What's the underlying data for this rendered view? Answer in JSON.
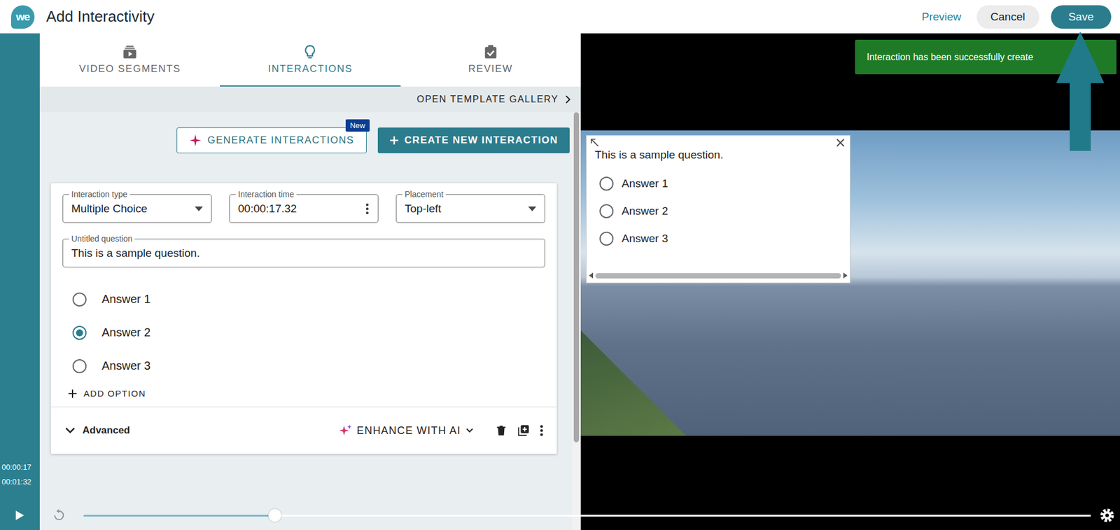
{
  "header": {
    "logo": "we",
    "title": "Add Interactivity",
    "buttons": [
      {
        "label": "Preview",
        "kind": "link"
      },
      {
        "label": "Cancel",
        "kind": "secondary"
      },
      {
        "label": "Save",
        "kind": "primary"
      }
    ]
  },
  "tabs": [
    {
      "label": "VIDEO SEGMENTS",
      "selected": false
    },
    {
      "label": "INTERACTIONS",
      "selected": true
    },
    {
      "label": "REVIEW",
      "selected": false
    }
  ],
  "template_gallery": {
    "label": "OPEN TEMPLATE GALLERY"
  },
  "actions": {
    "generate": {
      "label": "GENERATE INTERACTIONS",
      "badge": "New"
    },
    "create": {
      "label": "CREATE NEW INTERACTION"
    }
  },
  "interaction": {
    "fields": [
      {
        "label": "Interaction type",
        "value": "Multiple Choice",
        "kind": "select"
      },
      {
        "label": "Interaction time",
        "value": "00:00:17.32",
        "kind": "time"
      },
      {
        "label": "Placement",
        "value": "Top-left",
        "kind": "select"
      }
    ],
    "question": {
      "label": "Untitled question",
      "value": "This is a sample question."
    },
    "answers": [
      {
        "label": "Answer 1",
        "selected": false
      },
      {
        "label": "Answer 2",
        "selected": true
      },
      {
        "label": "Answer 3",
        "selected": false
      }
    ],
    "add_option": {
      "label": "ADD OPTION"
    },
    "advanced": {
      "label": "Advanced",
      "expanded": false
    },
    "enhance": {
      "label": "ENHANCE WITH AI"
    }
  },
  "player": {
    "current_time": "00:00:17",
    "duration": "00:01:32",
    "progress": {
      "level": 0.19
    }
  },
  "preview_overlay": {
    "question": "This is a sample question.",
    "answers": [
      {
        "label": "Answer 1",
        "selected": false
      },
      {
        "label": "Answer 2",
        "selected": false
      },
      {
        "label": "Answer 3",
        "selected": false
      }
    ]
  },
  "toast": {
    "message": "Interaction has been successfully create"
  }
}
